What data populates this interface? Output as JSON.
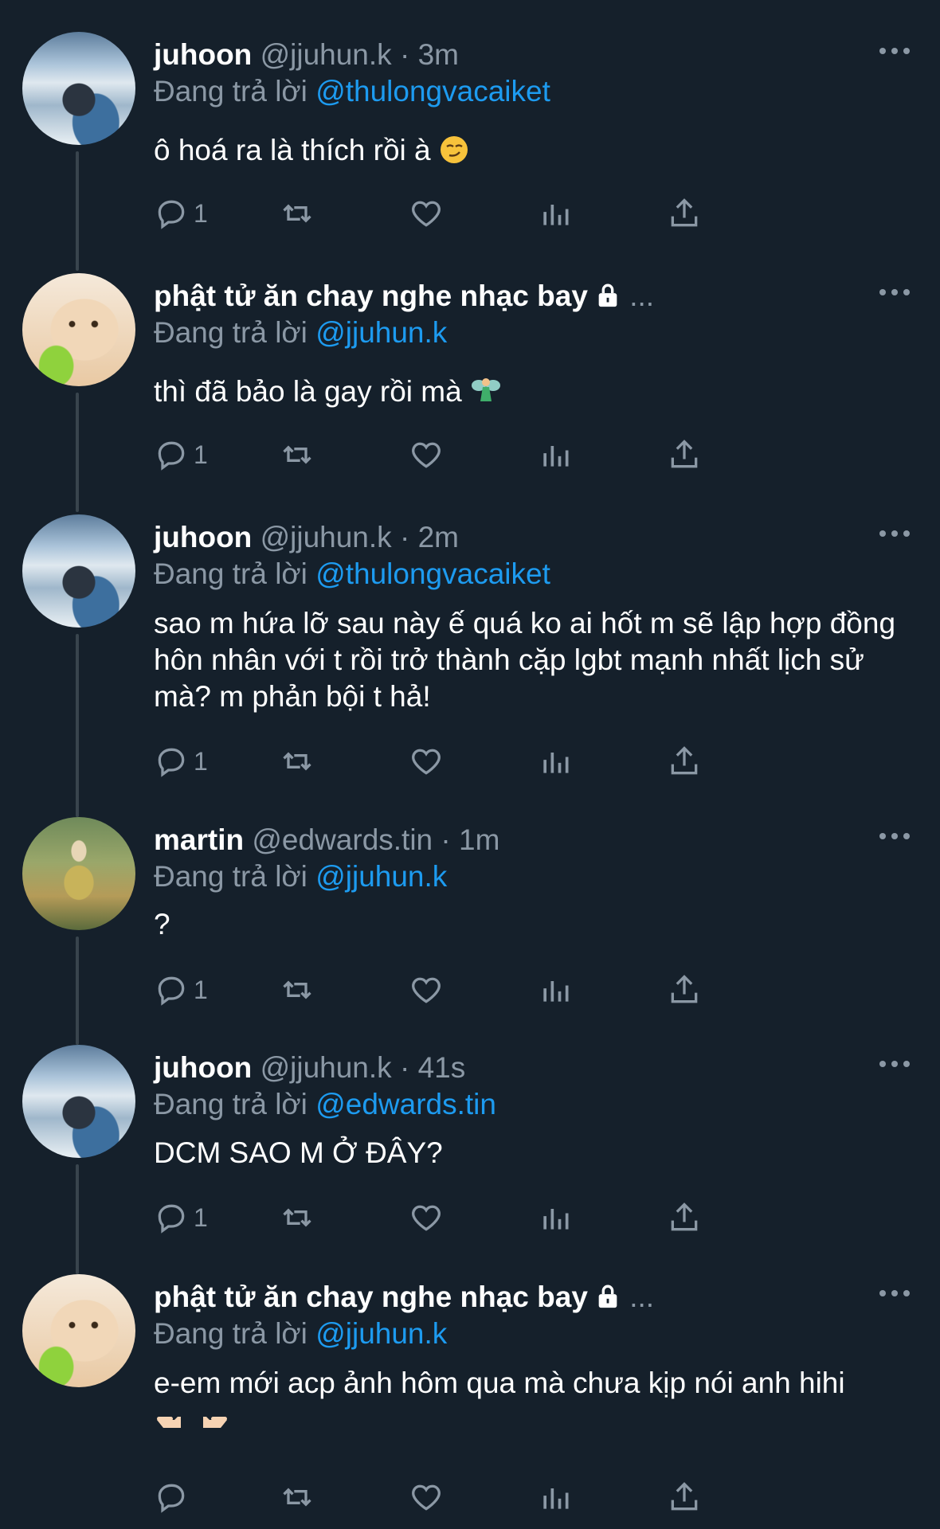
{
  "replying_prefix": "Đang trả lời",
  "tweets": [
    {
      "name": "juhoon",
      "handle": "@jjuhun.k",
      "sep": "·",
      "time": "3m",
      "reply_to": "@thulongvacaiket",
      "text": "ô hoá ra là thích rồi à",
      "emoji": "smirk-emoji",
      "replies": "1"
    },
    {
      "name": "phật tử ăn chay nghe nhạc bay",
      "ellipsis": "...",
      "reply_to": "@jjuhun.k",
      "text": "thì đã bảo là gay rồi mà",
      "emoji": "fairy-emoji",
      "replies": "1"
    },
    {
      "name": "juhoon",
      "handle": "@jjuhun.k",
      "sep": "·",
      "time": "2m",
      "reply_to": "@thulongvacaiket",
      "text": "sao m hứa lỡ sau này ế quá ko ai hốt m sẽ lập hợp đồng hôn nhân với t rồi trở thành cặp lgbt mạnh nhất lịch sử mà? m phản bội t hả!",
      "replies": "1"
    },
    {
      "name": "martin",
      "handle": "@edwards.tin",
      "sep": "·",
      "time": "1m",
      "reply_to": "@jjuhun.k",
      "text": "?",
      "replies": "1"
    },
    {
      "name": "juhoon",
      "handle": "@jjuhun.k",
      "sep": "·",
      "time": "41s",
      "reply_to": "@edwards.tin",
      "text": "DCM SAO M Ở ĐÂY?",
      "replies": "1"
    },
    {
      "name": "phật tử ăn chay nghe nhạc bay",
      "ellipsis": "...",
      "reply_to": "@jjuhun.k",
      "text": "e-em mới acp ảnh hôm qua mà chưa kịp nói anh hihi",
      "emoji": "pointing-fingers-emoji",
      "replies": ""
    }
  ]
}
